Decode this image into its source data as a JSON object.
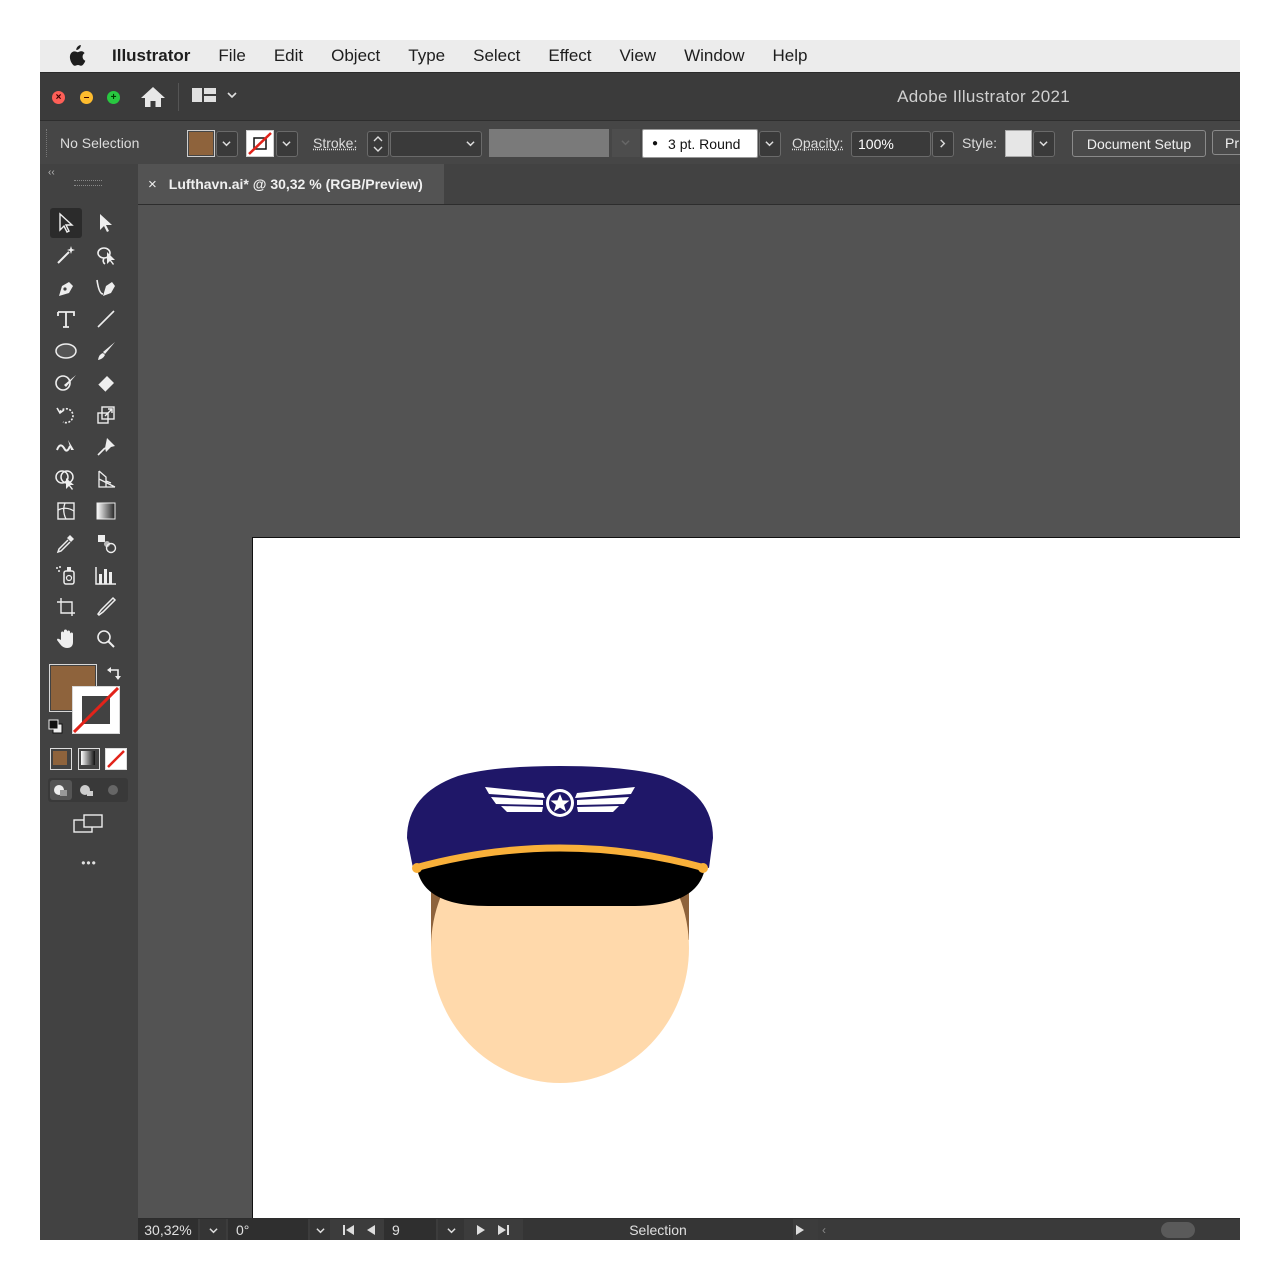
{
  "menubar": {
    "app_name": "Illustrator",
    "items": [
      "File",
      "Edit",
      "Object",
      "Type",
      "Select",
      "Effect",
      "View",
      "Window",
      "Help"
    ]
  },
  "titlebar": {
    "title": "Adobe Illustrator 2021"
  },
  "control_bar": {
    "selection_status": "No Selection",
    "fill_color": "#8e633c",
    "stroke_label": "Stroke:",
    "brush": "3 pt. Round",
    "opacity_label": "Opacity:",
    "opacity_value": "100%",
    "style_label": "Style:",
    "document_setup_label": "Document Setup",
    "preferences_label": "Pr"
  },
  "document_tab": {
    "close_glyph": "×",
    "label": "Lufthavn.ai* @ 30,32 % (RGB/Preview)"
  },
  "toolbar": {
    "fill_color": "#8e633c",
    "more_glyph": "•••",
    "tools": [
      "selection",
      "direct-selection",
      "magic-wand",
      "lasso",
      "pen",
      "curvature",
      "type",
      "line-segment",
      "ellipse",
      "paintbrush",
      "shaper",
      "eraser",
      "rotate",
      "scale",
      "warp",
      "puppet-warp",
      "shape-builder",
      "perspective-grid",
      "mesh",
      "gradient",
      "eyedropper",
      "blend",
      "symbol-sprayer",
      "column-graph",
      "artboard",
      "slice",
      "hand",
      "zoom"
    ]
  },
  "artwork": {
    "colors": {
      "face": "#ffd9ab",
      "hair": "#8e633c",
      "cap": "#1f1768",
      "visor": "#000000",
      "band": "#f9b03a",
      "emblem": "#ffffff"
    }
  },
  "status_bar": {
    "zoom": "30,32%",
    "rotation": "0°",
    "artboard_number": "9",
    "tool": "Selection"
  }
}
